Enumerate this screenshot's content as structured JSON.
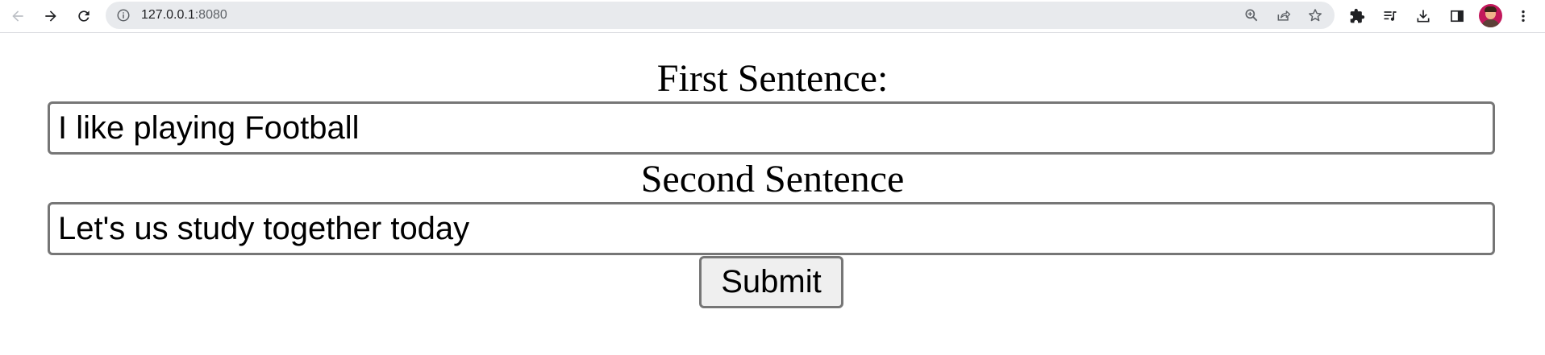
{
  "browser": {
    "url_host": "127.0.0.1",
    "url_port": ":8080",
    "toolbar_icons": [
      "back-icon",
      "forward-icon",
      "reload-icon",
      "info-icon",
      "zoom-icon",
      "share-icon",
      "star-icon",
      "extensions-icon",
      "media-icon",
      "download-icon",
      "side-panel-icon",
      "avatar",
      "menu-icon"
    ]
  },
  "form": {
    "first_label": "First Sentence:",
    "first_value": "I like playing Football",
    "second_label": "Second Sentence",
    "second_value": "Let's us study together today",
    "submit_label": "Submit"
  }
}
